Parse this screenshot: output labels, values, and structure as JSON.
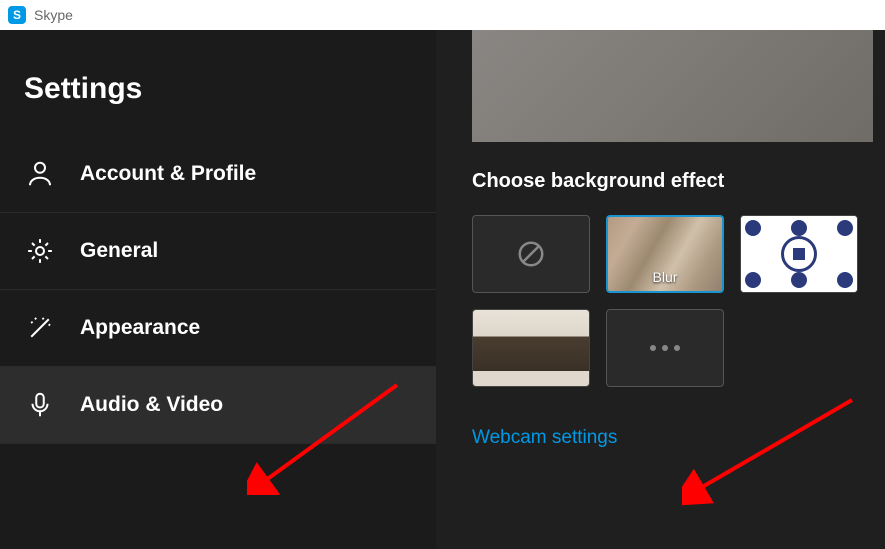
{
  "app": {
    "name": "Skype"
  },
  "sidebar": {
    "title": "Settings",
    "items": [
      {
        "label": "Account & Profile"
      },
      {
        "label": "General"
      },
      {
        "label": "Appearance"
      },
      {
        "label": "Audio & Video"
      }
    ]
  },
  "content": {
    "bg_section_title": "Choose background effect",
    "tiles": {
      "blur_label": "Blur"
    },
    "webcam_link": "Webcam settings"
  }
}
